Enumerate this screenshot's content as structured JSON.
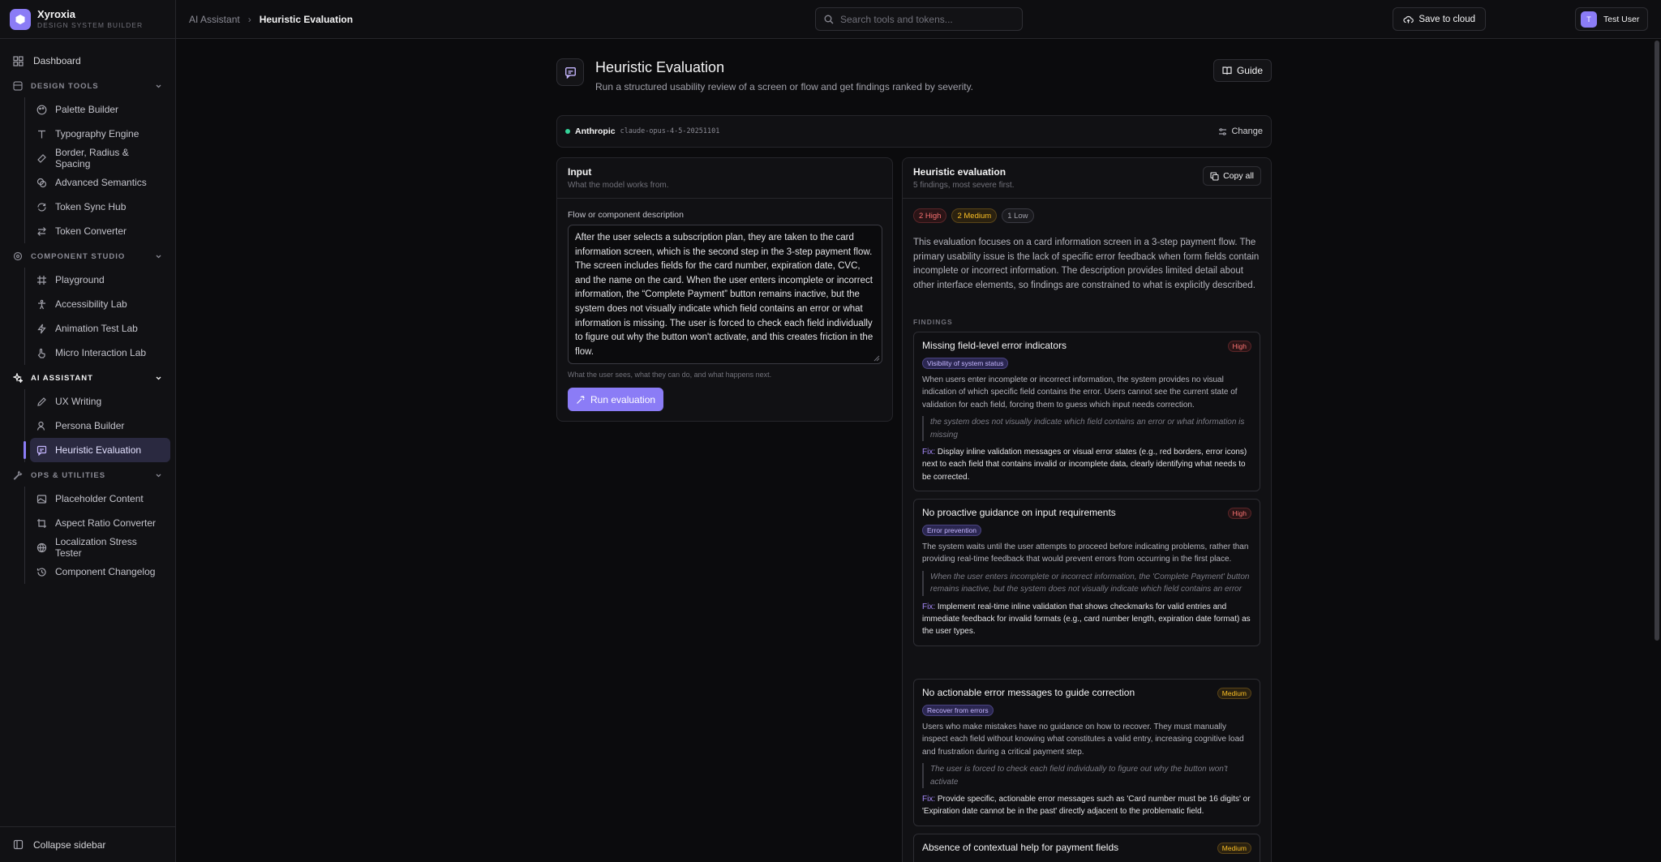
{
  "brand": {
    "name": "Xyroxia",
    "subtitle": "DESIGN SYSTEM BUILDER"
  },
  "sidebar": {
    "dashboard": "Dashboard",
    "sections": [
      {
        "label": "DESIGN TOOLS",
        "items": [
          "Palette Builder",
          "Typography Engine",
          "Border, Radius & Spacing",
          "Advanced Semantics",
          "Token Sync Hub",
          "Token Converter"
        ]
      },
      {
        "label": "COMPONENT STUDIO",
        "items": [
          "Playground",
          "Accessibility Lab",
          "Animation Test Lab",
          "Micro Interaction Lab"
        ]
      },
      {
        "label": "AI ASSISTANT",
        "items": [
          "UX Writing",
          "Persona Builder",
          "Heuristic Evaluation"
        ]
      },
      {
        "label": "OPS & UTILITIES",
        "items": [
          "Placeholder Content",
          "Aspect Ratio Converter",
          "Localization Stress Tester",
          "Component Changelog"
        ]
      }
    ],
    "active_item": "Heuristic Evaluation",
    "collapse_label": "Collapse sidebar"
  },
  "topbar": {
    "breadcrumb_parent": "AI Assistant",
    "breadcrumb_current": "Heuristic Evaluation",
    "search_placeholder": "Search tools and tokens...",
    "save_label": "Save to cloud",
    "user_initial": "T",
    "user_name": "Test User"
  },
  "page": {
    "title": "Heuristic Evaluation",
    "subtitle": "Run a structured usability review of a screen or flow and get findings ranked by severity.",
    "guide_label": "Guide"
  },
  "model": {
    "provider": "Anthropic",
    "id": "claude-opus-4-5-20251101",
    "change_label": "Change"
  },
  "input_panel": {
    "title": "Input",
    "subtitle": "What the model works from.",
    "field_label": "Flow or component description",
    "field_value": "After the user selects a subscription plan, they are taken to the card information screen, which is the second step in the 3-step payment flow. The screen includes fields for the card number, expiration date, CVC, and the name on the card. When the user enters incomplete or incorrect information, the “Complete Payment” button remains inactive, but the system does not visually indicate which field contains an error or what information is missing. The user is forced to check each field individually to figure out why the button won't activate, and this creates friction in the flow.",
    "hint": "What the user sees, what they can do, and what happens next.",
    "run_label": "Run evaluation"
  },
  "results": {
    "title": "Heuristic evaluation",
    "subtitle": "5 findings, most severe first.",
    "copy_label": "Copy all",
    "counts": {
      "high": "2 High",
      "medium": "2 Medium",
      "low": "1 Low"
    },
    "summary": "This evaluation focuses on a card information screen in a 3-step payment flow. The primary usability issue is the lack of specific error feedback when form fields contain incomplete or incorrect information. The description provides limited detail about other interface elements, so findings are constrained to what is explicitly described.",
    "findings_label": "FINDINGS",
    "fix_label": "Fix:",
    "findings": [
      {
        "title": "Missing field-level error indicators",
        "severity": "High",
        "heuristic": "Visibility of system status",
        "body": "When users enter incomplete or incorrect information, the system provides no visual indication of which specific field contains the error. Users cannot see the current state of validation for each field, forcing them to guess which input needs correction.",
        "quote": "the system does not visually indicate which field contains an error or what information is missing",
        "fix": "Display inline validation messages or visual error states (e.g., red borders, error icons) next to each field that contains invalid or incomplete data, clearly identifying what needs to be corrected."
      },
      {
        "title": "No proactive guidance on input requirements",
        "severity": "High",
        "heuristic": "Error prevention",
        "body": "The system waits until the user attempts to proceed before indicating problems, rather than providing real-time feedback that would prevent errors from occurring in the first place.",
        "quote": "When the user enters incomplete or incorrect information, the 'Complete Payment' button remains inactive, but the system does not visually indicate which field contains an error",
        "fix": "Implement real-time inline validation that shows checkmarks for valid entries and immediate feedback for invalid formats (e.g., card number length, expiration date format) as the user types."
      },
      {
        "title": "No actionable error messages to guide correction",
        "severity": "Medium",
        "heuristic": "Recover from errors",
        "body": "Users who make mistakes have no guidance on how to recover. They must manually inspect each field without knowing what constitutes a valid entry, increasing cognitive load and frustration during a critical payment step.",
        "quote": "The user is forced to check each field individually to figure out why the button won't activate",
        "fix": "Provide specific, actionable error messages such as 'Card number must be 16 digits' or 'Expiration date cannot be in the past' directly adjacent to the problematic field."
      },
      {
        "title": "Absence of contextual help for payment fields",
        "severity": "Medium"
      }
    ]
  }
}
